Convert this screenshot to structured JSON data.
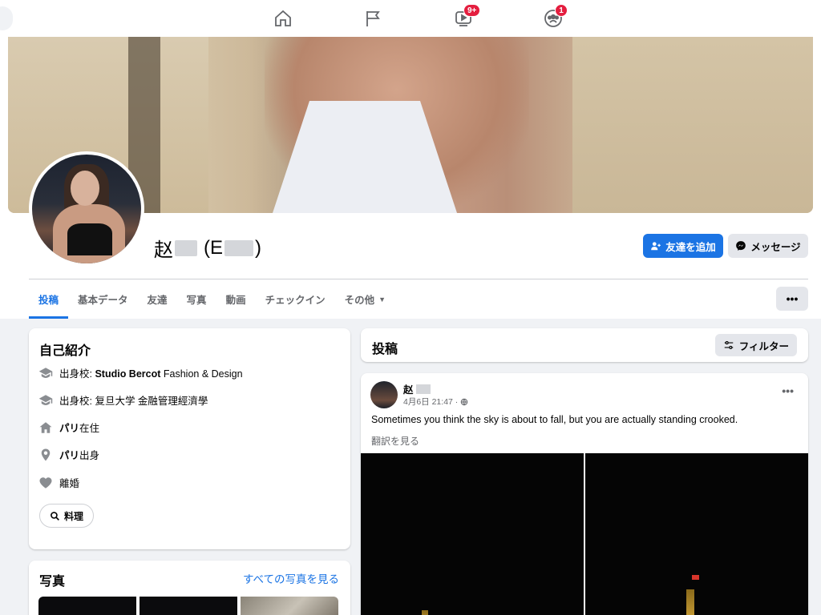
{
  "topnav": {
    "video_badge": "9+",
    "groups_badge": "1"
  },
  "profile": {
    "name_prefix": "赵",
    "name_alias_open": "(E",
    "name_alias_close": ")",
    "add_friend_label": "友達を追加",
    "message_label": "メッセージ"
  },
  "tabs": [
    {
      "label": "投稿"
    },
    {
      "label": "基本データ"
    },
    {
      "label": "友達"
    },
    {
      "label": "写真"
    },
    {
      "label": "動画"
    },
    {
      "label": "チェックイン"
    },
    {
      "label": "その他"
    }
  ],
  "intro": {
    "title": "自己紹介",
    "items": [
      {
        "prefix": "出身校: ",
        "bold": "Studio Bercot",
        "suffix": " Fashion & Design",
        "icon": "graduation-cap-icon"
      },
      {
        "prefix": "出身校: ",
        "bold": "",
        "suffix": "复旦大学 金融管理經濟學",
        "icon": "graduation-cap-icon"
      },
      {
        "prefix": "",
        "bold": "パリ",
        "suffix": "在住",
        "icon": "home-icon"
      },
      {
        "prefix": "",
        "bold": "パリ",
        "suffix": "出身",
        "icon": "location-pin-icon"
      },
      {
        "prefix": "",
        "bold": "",
        "suffix": "離婚",
        "icon": "heart-icon"
      }
    ],
    "chip_label": "料理"
  },
  "photos": {
    "title": "写真",
    "see_all": "すべての写真を見る"
  },
  "posts": {
    "title": "投稿",
    "filter_label": "フィルター"
  },
  "post": {
    "author": "赵",
    "date": "4月6日 21:47 ·",
    "text": "Sometimes you think the sky is about to fall, but you are actually standing crooked.",
    "translate": "翻訳を見る"
  },
  "colors": {
    "accent": "#1b74e4",
    "badge": "#e41e3f",
    "page_bg": "#f0f2f5"
  }
}
